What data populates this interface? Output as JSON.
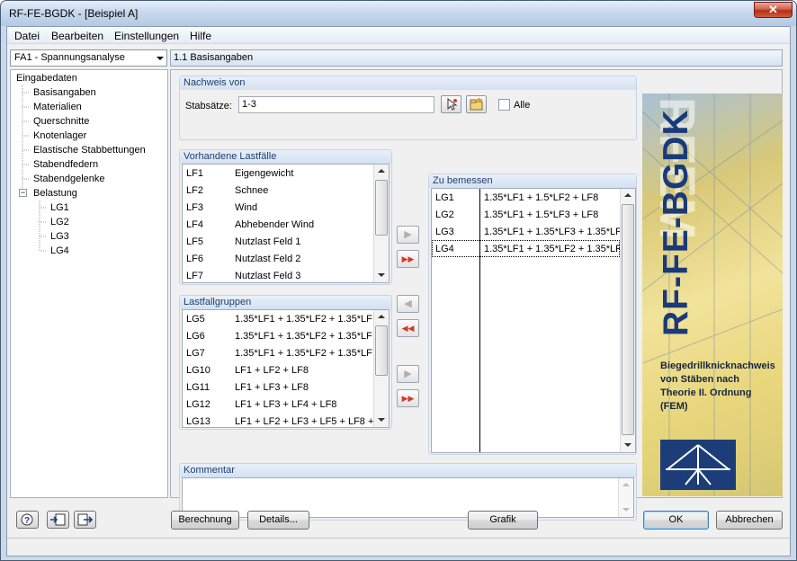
{
  "window": {
    "title": "RF-FE-BGDK - [Beispiel A]",
    "close_glyph": "✕"
  },
  "menu": [
    "Datei",
    "Bearbeiten",
    "Einstellungen",
    "Hilfe"
  ],
  "case_select": {
    "value": "FA1 - Spannungsanalyse"
  },
  "nav": {
    "root": "Eingabedaten",
    "items": [
      "Basisangaben",
      "Materialien",
      "Querschnitte",
      "Knotenlager",
      "Elastische Stabbettungen",
      "Stabendfedern",
      "Stabendgelenke"
    ],
    "belastung": "Belastung",
    "belastung_toggle": "−",
    "subitems": [
      "LG1",
      "LG2",
      "LG3",
      "LG4"
    ]
  },
  "header": {
    "title": "1.1 Basisangaben"
  },
  "nachweis": {
    "title": "Nachweis von",
    "label": "Stabsätze:",
    "value": "1-3",
    "alle_label": "Alle"
  },
  "vorhandene": {
    "title": "Vorhandene Lastfälle",
    "rows": [
      [
        "LF1",
        "Eigengewicht"
      ],
      [
        "LF2",
        "Schnee"
      ],
      [
        "LF3",
        "Wind"
      ],
      [
        "LF4",
        "Abhebender Wind"
      ],
      [
        "LF5",
        "Nutzlast Feld 1"
      ],
      [
        "LF6",
        "Nutzlast Feld 2"
      ],
      [
        "LF7",
        "Nutzlast Feld 3"
      ]
    ]
  },
  "lastfallgruppen": {
    "title": "Lastfallgruppen",
    "rows": [
      [
        "LG5",
        "1.35*LF1 + 1.35*LF2 + 1.35*LF"
      ],
      [
        "LG6",
        "1.35*LF1 + 1.35*LF2 + 1.35*LF"
      ],
      [
        "LG7",
        "1.35*LF1 + 1.35*LF2 + 1.35*LF"
      ],
      [
        "LG10",
        "LF1 + LF2 + LF8"
      ],
      [
        "LG11",
        "LF1 + LF3 + LF8"
      ],
      [
        "LG12",
        "LF1 + LF3 + LF4 + LF8"
      ],
      [
        "LG13",
        "LF1 + LF2 + LF3 + LF5 + LF8 +"
      ]
    ]
  },
  "zu_bemessen": {
    "title": "Zu bemessen",
    "rows": [
      [
        "LG1",
        "1.35*LF1 + 1.5*LF2 + LF8"
      ],
      [
        "LG2",
        "1.35*LF1 + 1.5*LF3 + LF8"
      ],
      [
        "LG3",
        "1.35*LF1 + 1.35*LF3 + 1.35*LF"
      ],
      [
        "LG4",
        "1.35*LF1 + 1.35*LF2 + 1.35*LF"
      ]
    ]
  },
  "move_buttons": {
    "add": "▶",
    "add_all": "▶▶",
    "remove": "◀",
    "remove_all": "◀◀"
  },
  "kommentar": {
    "title": "Kommentar",
    "value": ""
  },
  "banner": {
    "big_text": "RF-FE-BGDK",
    "ghost_text": "RFEM",
    "description": [
      "Biegedrillknicknachweis",
      "von Stäben nach",
      "Theorie II. Ordnung",
      "(FEM)"
    ]
  },
  "buttons": {
    "berechnung": "Berechnung",
    "details": "Details...",
    "grafik": "Grafik",
    "ok": "OK",
    "abbrechen": "Abbrechen"
  },
  "colors": {
    "accent_blue": "#1a3a7a",
    "header_blue": "#1f3e6e",
    "add_all_arrows": "#d0392b"
  }
}
